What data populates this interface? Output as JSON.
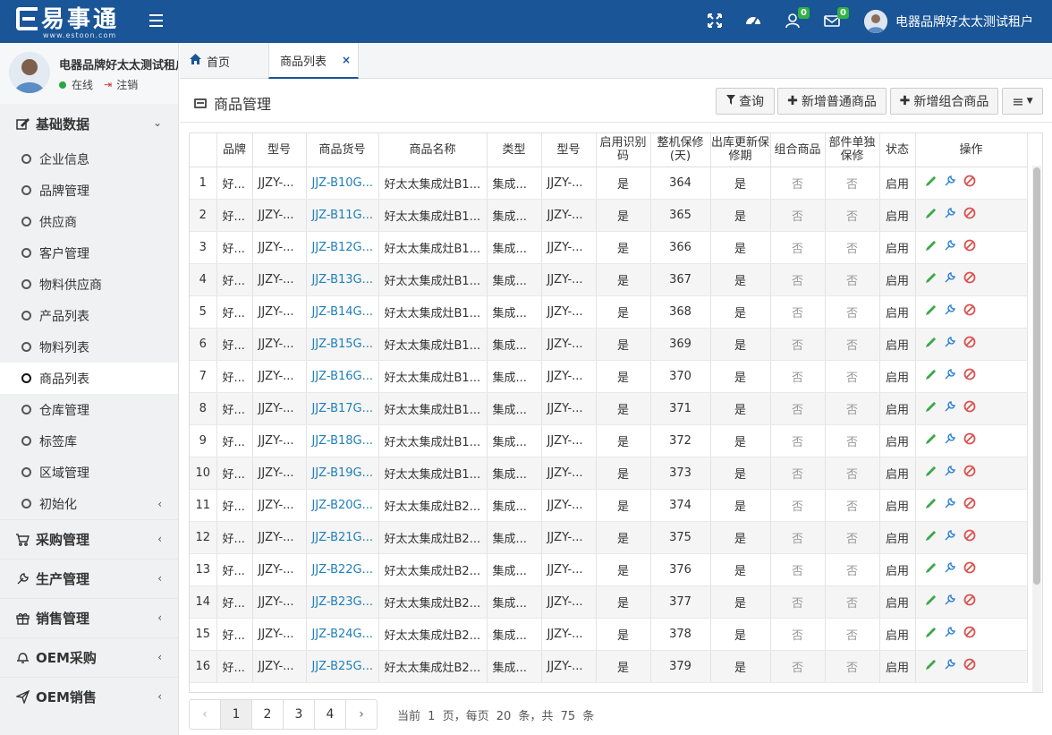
{
  "app": {
    "logo_text": "易事通",
    "logo_sub": "www.estoon.com",
    "user_name": "电器品牌好太太测试租户",
    "notif_count": "0",
    "mail_count": "0"
  },
  "sidebar": {
    "user_name": "电器品牌好太太测试租户",
    "status": "在线",
    "logout": "注销",
    "groups": [
      {
        "label": "基础数据",
        "icon": "edit-icon"
      },
      {
        "label": "采购管理",
        "icon": "cart-icon"
      },
      {
        "label": "生产管理",
        "icon": "wrench-icon"
      },
      {
        "label": "销售管理",
        "icon": "gift-icon"
      },
      {
        "label": "OEM采购",
        "icon": "bell-icon"
      },
      {
        "label": "OEM销售",
        "icon": "send-icon"
      }
    ],
    "items": [
      "企业信息",
      "品牌管理",
      "供应商",
      "客户管理",
      "物料供应商",
      "产品列表",
      "物料列表",
      "商品列表",
      "仓库管理",
      "标签库",
      "区域管理",
      "初始化"
    ],
    "active_item": "商品列表"
  },
  "tabs": {
    "home": "首页",
    "current": "商品列表",
    "close": "×"
  },
  "page": {
    "title": "商品管理",
    "buttons": {
      "query": "查询",
      "add_normal": "新增普通商品",
      "add_combo": "新增组合商品",
      "menu": "≡"
    }
  },
  "table": {
    "headers": [
      "",
      "品牌",
      "型号",
      "商品货号",
      "商品名称",
      "类型",
      "型号",
      "启用识别码",
      "整机保修(天)",
      "出库更新保修期",
      "组合商品",
      "部件单独保修",
      "状态",
      "操作"
    ],
    "rows": [
      [
        "1",
        "好...",
        "JJZY-...",
        "JJZ-B10G...",
        "好太太集成灶B1...",
        "集成...",
        "JJZY-...",
        "是",
        "364",
        "是",
        "否",
        "否",
        "启用"
      ],
      [
        "2",
        "好...",
        "JJZY-...",
        "JJZ-B11G...",
        "好太太集成灶B1...",
        "集成...",
        "JJZY-...",
        "是",
        "365",
        "是",
        "否",
        "否",
        "启用"
      ],
      [
        "3",
        "好...",
        "JJZY-...",
        "JJZ-B12G...",
        "好太太集成灶B1...",
        "集成...",
        "JJZY-...",
        "是",
        "366",
        "是",
        "否",
        "否",
        "启用"
      ],
      [
        "4",
        "好...",
        "JJZY-...",
        "JJZ-B13G...",
        "好太太集成灶B1...",
        "集成...",
        "JJZY-...",
        "是",
        "367",
        "是",
        "否",
        "否",
        "启用"
      ],
      [
        "5",
        "好...",
        "JJZY-...",
        "JJZ-B14G...",
        "好太太集成灶B1...",
        "集成...",
        "JJZY-...",
        "是",
        "368",
        "是",
        "否",
        "否",
        "启用"
      ],
      [
        "6",
        "好...",
        "JJZY-...",
        "JJZ-B15G...",
        "好太太集成灶B1...",
        "集成...",
        "JJZY-...",
        "是",
        "369",
        "是",
        "否",
        "否",
        "启用"
      ],
      [
        "7",
        "好...",
        "JJZY-...",
        "JJZ-B16G...",
        "好太太集成灶B1...",
        "集成...",
        "JJZY-...",
        "是",
        "370",
        "是",
        "否",
        "否",
        "启用"
      ],
      [
        "8",
        "好...",
        "JJZY-...",
        "JJZ-B17G...",
        "好太太集成灶B1...",
        "集成...",
        "JJZY-...",
        "是",
        "371",
        "是",
        "否",
        "否",
        "启用"
      ],
      [
        "9",
        "好...",
        "JJZY-...",
        "JJZ-B18G...",
        "好太太集成灶B1...",
        "集成...",
        "JJZY-...",
        "是",
        "372",
        "是",
        "否",
        "否",
        "启用"
      ],
      [
        "10",
        "好...",
        "JJZY-...",
        "JJZ-B19G...",
        "好太太集成灶B1...",
        "集成...",
        "JJZY-...",
        "是",
        "373",
        "是",
        "否",
        "否",
        "启用"
      ],
      [
        "11",
        "好...",
        "JJZY-...",
        "JJZ-B20G...",
        "好太太集成灶B2...",
        "集成...",
        "JJZY-...",
        "是",
        "374",
        "是",
        "否",
        "否",
        "启用"
      ],
      [
        "12",
        "好...",
        "JJZY-...",
        "JJZ-B21G...",
        "好太太集成灶B2...",
        "集成...",
        "JJZY-...",
        "是",
        "375",
        "是",
        "否",
        "否",
        "启用"
      ],
      [
        "13",
        "好...",
        "JJZY-...",
        "JJZ-B22G...",
        "好太太集成灶B2...",
        "集成...",
        "JJZY-...",
        "是",
        "376",
        "是",
        "否",
        "否",
        "启用"
      ],
      [
        "14",
        "好...",
        "JJZY-...",
        "JJZ-B23G...",
        "好太太集成灶B2...",
        "集成...",
        "JJZY-...",
        "是",
        "377",
        "是",
        "否",
        "否",
        "启用"
      ],
      [
        "15",
        "好...",
        "JJZY-...",
        "JJZ-B24G...",
        "好太太集成灶B2...",
        "集成...",
        "JJZY-...",
        "是",
        "378",
        "是",
        "否",
        "否",
        "启用"
      ],
      [
        "16",
        "好...",
        "JJZY-...",
        "JJZ-B25G...",
        "好太太集成灶B2...",
        "集成...",
        "JJZY-...",
        "是",
        "379",
        "是",
        "否",
        "否",
        "启用"
      ]
    ]
  },
  "pagination": {
    "prev": "‹",
    "next": "›",
    "pages": [
      "1",
      "2",
      "3",
      "4"
    ],
    "current": "1",
    "info_prefix": "当前",
    "info_page": "1",
    "info_mid": "页，每页",
    "info_per": "20",
    "info_suffix": "条，共",
    "info_total": "75",
    "info_end": "条"
  },
  "colors": {
    "primary": "#1a5597",
    "link": "#1e7fba",
    "edit": "#3aa845",
    "config": "#2a7fd1",
    "disable": "#d9534f",
    "badge": "#2fb344"
  }
}
